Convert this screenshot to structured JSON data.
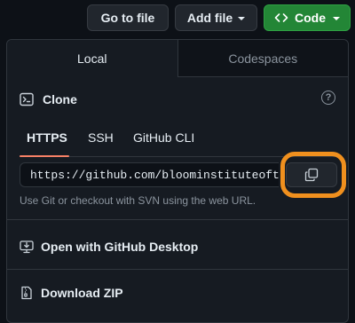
{
  "toolbar": {
    "go_to_file": "Go to file",
    "add_file": "Add file",
    "code": "Code",
    "code_icon": "code-brackets-icon",
    "code_color": "#238636"
  },
  "tabs": [
    {
      "label": "Local",
      "active": true
    },
    {
      "label": "Codespaces",
      "active": false
    }
  ],
  "clone": {
    "title": "Clone",
    "icon": "terminal-icon",
    "help_icon": "question-icon",
    "help_glyph": "?",
    "protocols": [
      {
        "label": "HTTPS",
        "active": true
      },
      {
        "label": "SSH",
        "active": false
      },
      {
        "label": "GitHub CLI",
        "active": false
      }
    ],
    "url": "https://github.com/bloominstituteoftechnology/",
    "copy_icon": "copy-icon",
    "hint": "Use Git or checkout with SVN using the web URL."
  },
  "actions": {
    "open_desktop": "Open with GitHub Desktop",
    "open_desktop_icon": "desktop-download-icon",
    "download_zip": "Download ZIP",
    "download_zip_icon": "file-zip-icon"
  },
  "colors": {
    "highlight": "#f0901e",
    "active_underline": "#f78166",
    "panel_bg": "#161b22"
  }
}
